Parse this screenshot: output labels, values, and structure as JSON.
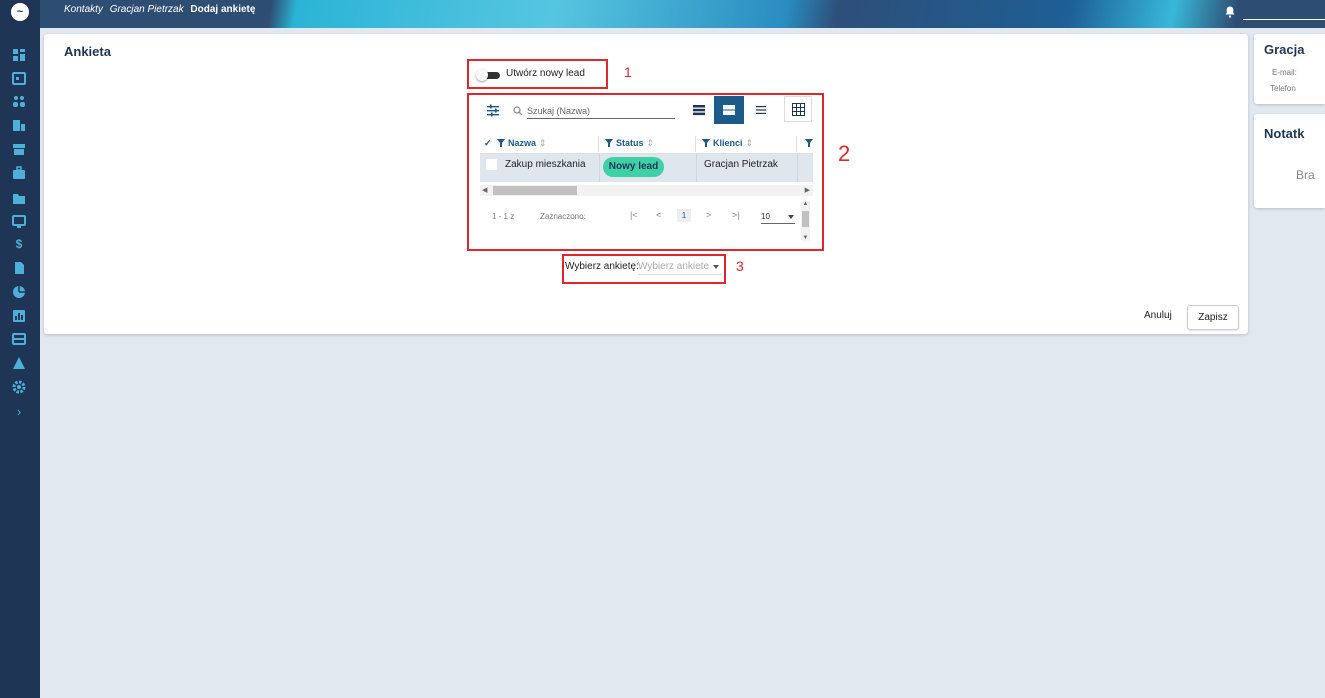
{
  "breadcrumb": [
    "Kontakty",
    "Gracjan Pietrzak",
    "Dodaj ankietę"
  ],
  "card": {
    "title": "Ankieta",
    "toggle_label": "Utwórz nowy lead",
    "toggle_on": false
  },
  "annotations": [
    "1",
    "2",
    "3"
  ],
  "grid": {
    "search_placeholder": "Szukaj (Nazwa)",
    "columns": [
      "Nazwa",
      "Status",
      "Klienci"
    ],
    "rows": [
      {
        "nazwa": "Zakup mieszkania",
        "status": "Nowy lead",
        "klienci": "Gracjan Pietrzak"
      }
    ],
    "pager": {
      "count": "1 - 1 z",
      "selected": "Zaznaczono:",
      "page": "1",
      "page_size": "10"
    }
  },
  "select": {
    "label": "Wybierz ankietę:",
    "placeholder": "Wybierz ankiete"
  },
  "buttons": {
    "cancel": "Anuluj",
    "save": "Zapisz"
  },
  "contact_panel": {
    "title": "Gracja",
    "email_label": "E-mail:",
    "phone_label": "Telefon"
  },
  "notes_panel": {
    "title": "Notatk",
    "empty": "Bra"
  },
  "colors": {
    "sidebar": "#1f3556",
    "accent": "#1b5b8a",
    "status_new_lead": "#3fd1a6",
    "annotation": "#e3262b"
  }
}
